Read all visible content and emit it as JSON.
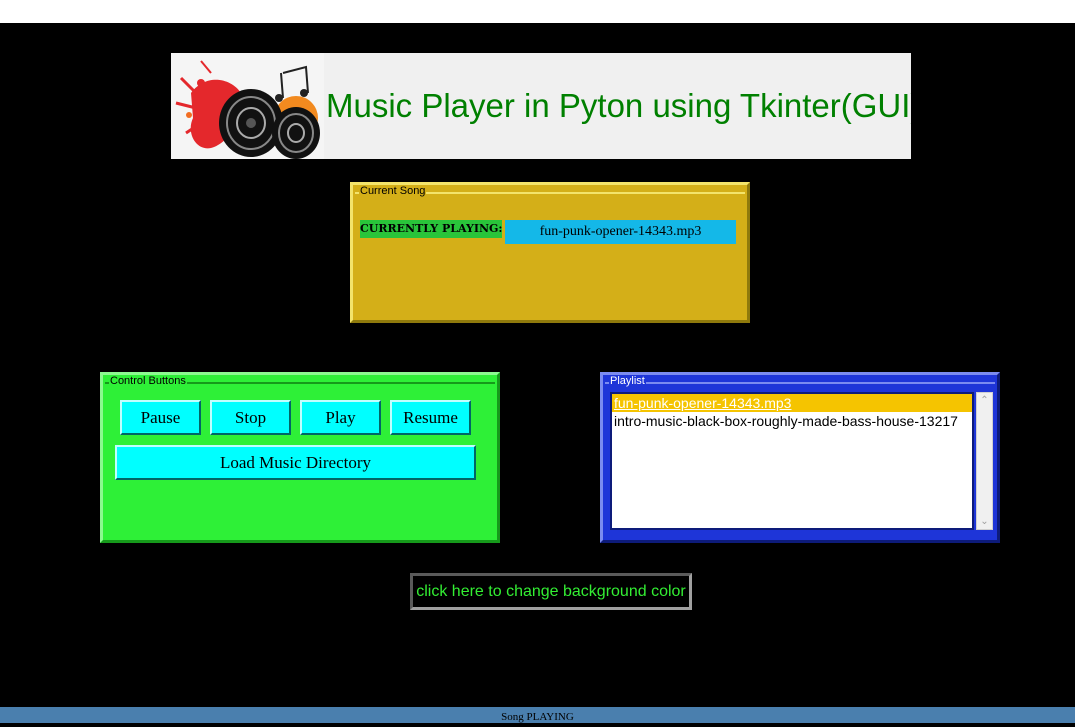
{
  "header": {
    "title": "Music Player in Pyton using Tkinter(GUI)",
    "image": "music-speaker-logo"
  },
  "current_song": {
    "legend": "Current Song",
    "label": "CURRENTLY PLAYING:",
    "value": "fun-punk-opener-14343.mp3"
  },
  "controls": {
    "legend": "Control Buttons",
    "pause": "Pause",
    "stop": "Stop",
    "play": "Play",
    "resume": "Resume",
    "load_dir": "Load Music Directory"
  },
  "playlist": {
    "legend": "Playlist",
    "items": [
      "fun-punk-opener-14343.mp3",
      "intro-music-black-box-roughly-made-bass-house-13217"
    ],
    "selected_index": 0
  },
  "bg_button": "click here to change background color",
  "status": "Song PLAYING",
  "colors": {
    "window_bg": "#000000",
    "current_song_bg": "#d4af18",
    "controls_bg": "#2ef037",
    "playlist_bg": "#1e35d8",
    "button_bg": "#00ffff",
    "title_color": "#008000",
    "selected_item": "#f5c400",
    "status_bar": "#4a7fae"
  }
}
